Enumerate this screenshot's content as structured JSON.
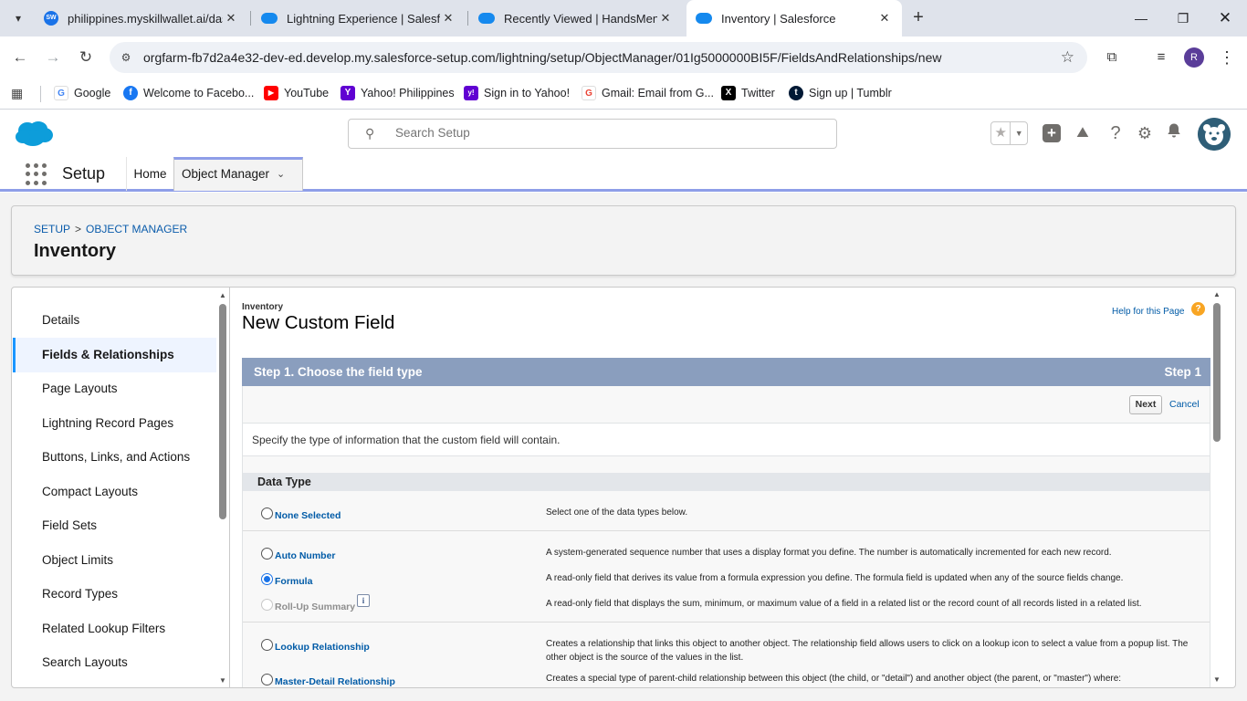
{
  "browser": {
    "tabs": [
      {
        "title": "philippines.myskillwallet.ai/dash",
        "icon": "skillwallet-icon"
      },
      {
        "title": "Lightning Experience | Salesforce",
        "icon": "salesforce-cloud-icon"
      },
      {
        "title": "Recently Viewed | HandsMen Cl",
        "icon": "salesforce-cloud-icon"
      },
      {
        "title": "Inventory | Salesforce",
        "icon": "salesforce-cloud-icon"
      }
    ],
    "url": "orgfarm-fb7d2a4e32-dev-ed.develop.my.salesforce-setup.com/lightning/setup/ObjectManager/01Ig5000000BI5F/FieldsAndRelationships/new",
    "profile_initial": "R",
    "bookmarks": [
      {
        "label": "Google",
        "icon": "G",
        "color": "#4285f4"
      },
      {
        "label": "Welcome to Facebo...",
        "icon": "f",
        "color": "#1877f2"
      },
      {
        "label": "YouTube",
        "icon": "▶",
        "color": "#ff0000"
      },
      {
        "label": "Yahoo! Philippines",
        "icon": "Y",
        "color": "#6001d2"
      },
      {
        "label": "Sign in to Yahoo!",
        "icon": "y!",
        "color": "#6001d2"
      },
      {
        "label": "Gmail: Email from G...",
        "icon": "G",
        "color": "#ea4335"
      },
      {
        "label": "Twitter",
        "icon": "X",
        "color": "#000000"
      },
      {
        "label": "Sign up | Tumblr",
        "icon": "t",
        "color": "#001935"
      }
    ]
  },
  "sf": {
    "search_placeholder": "Search Setup",
    "app_name": "Setup",
    "nav_home": "Home",
    "nav_object_manager": "Object Manager",
    "breadcrumb": {
      "setup": "SETUP",
      "separator": ">",
      "object_manager": "OBJECT MANAGER"
    },
    "page_title": "Inventory",
    "sidebar": [
      {
        "label": "Details",
        "active": false
      },
      {
        "label": "Fields & Relationships",
        "active": true
      },
      {
        "label": "Page Layouts",
        "active": false
      },
      {
        "label": "Lightning Record Pages",
        "active": false
      },
      {
        "label": "Buttons, Links, and Actions",
        "active": false
      },
      {
        "label": "Compact Layouts",
        "active": false
      },
      {
        "label": "Field Sets",
        "active": false
      },
      {
        "label": "Object Limits",
        "active": false
      },
      {
        "label": "Record Types",
        "active": false
      },
      {
        "label": "Related Lookup Filters",
        "active": false
      },
      {
        "label": "Search Layouts",
        "active": false
      }
    ]
  },
  "form": {
    "object_label": "Inventory",
    "title": "New Custom Field",
    "help_link": "Help for this Page",
    "step_title": "Step 1. Choose the field type",
    "step_indicator": "Step 1",
    "next_label": "Next",
    "cancel_label": "Cancel",
    "instruction": "Specify the type of information that the custom field will contain.",
    "section_title": "Data Type",
    "data_types": {
      "none": {
        "label": "None Selected",
        "desc": "Select one of the data types below.",
        "checked": false
      },
      "auto_number": {
        "label": "Auto Number",
        "desc": "A system-generated sequence number that uses a display format you define. The number is automatically incremented for each new record.",
        "checked": false
      },
      "formula": {
        "label": "Formula",
        "desc": "A read-only field that derives its value from a formula expression you define. The formula field is updated when any of the source fields change.",
        "checked": true
      },
      "rollup": {
        "label": "Roll-Up Summary",
        "desc": "A read-only field that displays the sum, minimum, or maximum value of a field in a related list or the record count of all records listed in a related list.",
        "checked": false,
        "disabled": true
      },
      "lookup": {
        "label": "Lookup Relationship",
        "desc": "Creates a relationship that links this object to another object. The relationship field allows users to click on a lookup icon to select a value from a popup list. The other object is the source of the values in the list.",
        "checked": false
      },
      "master_detail": {
        "label": "Master-Detail Relationship",
        "desc": "Creates a special type of parent-child relationship between this object (the child, or \"detail\") and another object (the parent, or \"master\") where:",
        "checked": false
      }
    }
  }
}
